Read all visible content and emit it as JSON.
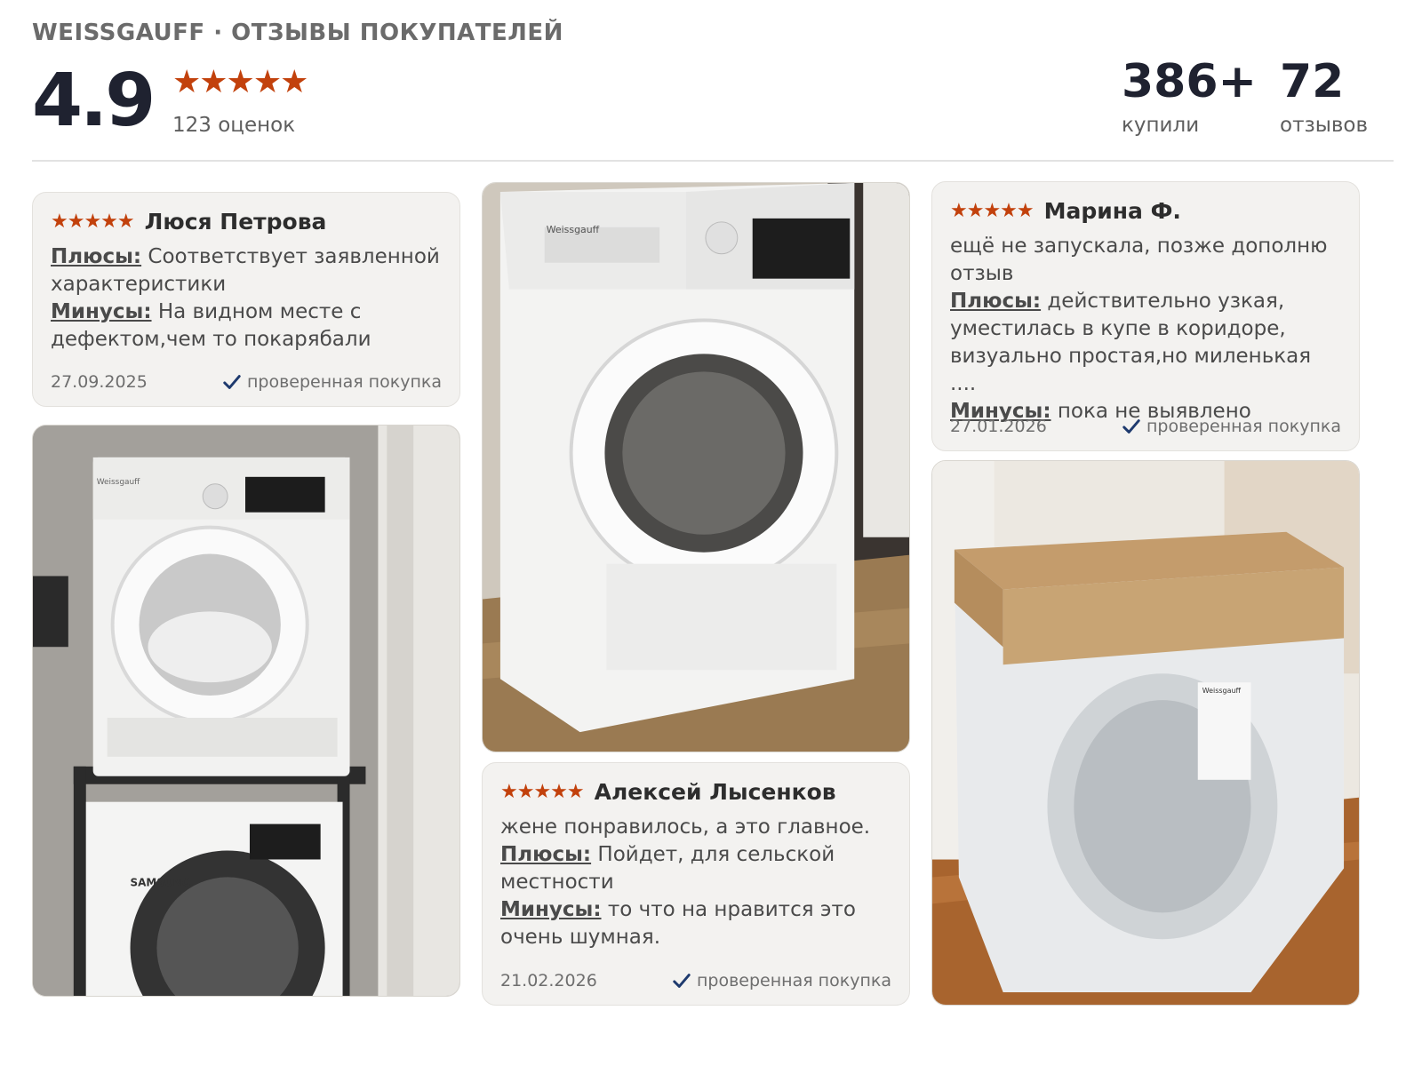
{
  "header": {
    "brand_line": "WEISSGAUFF · ОТЗЫВЫ ПОКУПАТЕЛЕЙ",
    "rating": "4.9",
    "stars": "★★★★★",
    "ratings_count": "123 оценок",
    "buyers_count": "386+",
    "buyers_label": "купили",
    "reviews_count": "72",
    "reviews_label": "отзывов"
  },
  "colors": {
    "star": "#c2410c",
    "card_bg": "#f3f2f0",
    "verified": "#1e3a6e",
    "title": "#1f2230"
  },
  "icons": {
    "verified": "check-icon",
    "star": "star-icon"
  },
  "reviews": [
    {
      "stars": "★★★★★",
      "author": "Люся Петрова",
      "intro": "",
      "pros_label": "Плюсы:",
      "pros": "Соответствует заявленной характеристики",
      "cons_label": "Минусы:",
      "cons": "На видном месте с дефектом,чем то покарябали",
      "date": "27.09.2025",
      "verified": "проверенная покупка"
    },
    {
      "stars": "★★★★★",
      "author": "Алексей Лысенков",
      "intro": "жене понравилось, а это главное.",
      "pros_label": "Плюсы:",
      "pros": "Пойдет, для сельской местности",
      "cons_label": "Минусы:",
      "cons": "то что на нравится это очень шумная.",
      "date": "21.02.2026",
      "verified": "проверенная покупка"
    },
    {
      "stars": "★★★★★",
      "author": "Марина Ф.",
      "intro": "ещё не запускала, позже дополню отзыв",
      "pros_label": "Плюсы:",
      "pros": "действительно узкая, уместилась в купе в коридоре, визуально простая,но миленькая ....",
      "cons_label": "Минусы:",
      "cons": "пока не выявлено",
      "date": "27.01.2026",
      "verified": "проверенная покупка"
    }
  ],
  "photos": {
    "photo1": {
      "brand": "Weissgauff",
      "lower_brand": "SAMSUNG"
    },
    "photo2": {
      "brand": "Weissgauff"
    },
    "photo3": {
      "brand": "Weissgauff"
    }
  }
}
